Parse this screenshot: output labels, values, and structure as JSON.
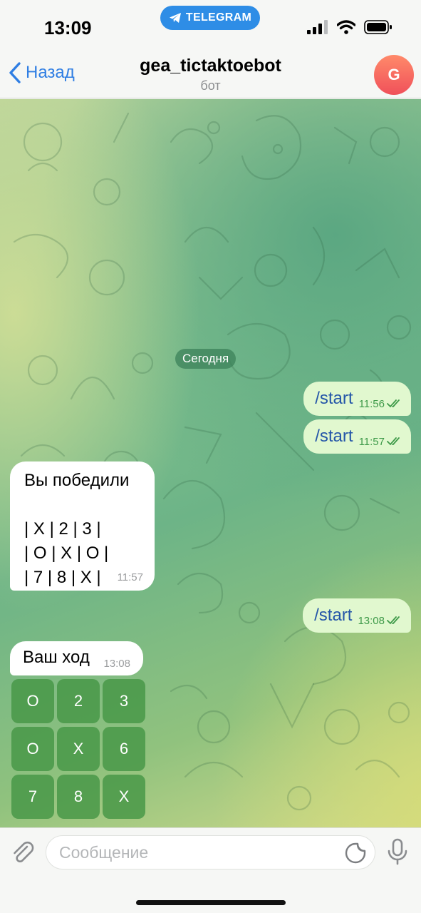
{
  "status": {
    "time": "13:09",
    "pill_label": "TELEGRAM",
    "icons": [
      "signal-icon",
      "wifi-icon",
      "battery-icon"
    ]
  },
  "nav": {
    "back_label": "Назад",
    "title": "gea_tictaktoebot",
    "subtitle": "бот",
    "avatar_letter": "G"
  },
  "chat": {
    "date_label": "Сегодня",
    "messages": [
      {
        "from": "me",
        "text": "/start",
        "time": "11:56",
        "read": true
      },
      {
        "from": "me",
        "text": "/start",
        "time": "11:57",
        "read": true
      },
      {
        "from": "bot",
        "text": "Вы победили\n\n| X | 2 | 3 |\n| O | X | O |\n| 7 | 8 | X |",
        "time": "11:57"
      },
      {
        "from": "me",
        "text": "/start",
        "time": "13:08",
        "read": true
      },
      {
        "from": "bot",
        "text": "Ваш ход",
        "time": "13:08"
      }
    ],
    "keyboard": [
      "O",
      "2",
      "3",
      "O",
      "X",
      "6",
      "7",
      "8",
      "X"
    ]
  },
  "input": {
    "placeholder": "Сообщение"
  },
  "colors": {
    "accent": "#2f7ee3",
    "outgoing_bubble": "#e1f8cf",
    "keyboard_button": "#46964a"
  }
}
